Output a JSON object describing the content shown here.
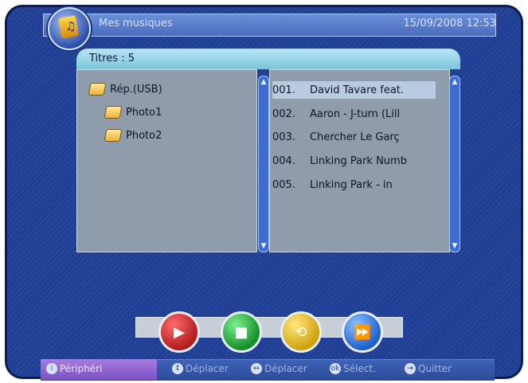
{
  "header": {
    "title": "Mes musiques",
    "datetime": "15/09/2008  12:53",
    "logo_icon": "music-folder-icon"
  },
  "panel": {
    "count_label": "Titres :   5"
  },
  "folders": [
    {
      "label": "Rép.(USB)",
      "icon": "folder-open-icon"
    },
    {
      "label": "Photo1",
      "icon": "folder-icon"
    },
    {
      "label": "Photo2",
      "icon": "folder-icon"
    }
  ],
  "tracks": [
    {
      "num": "001.",
      "title": "David Tavare feat."
    },
    {
      "num": "002.",
      "title": "Aaron - J-turn (Lill"
    },
    {
      "num": "003.",
      "title": "Chercher Le Garç"
    },
    {
      "num": "004.",
      "title": "Linking Park Numb"
    },
    {
      "num": "005.",
      "title": "Linking Park - in"
    }
  ],
  "controls": {
    "play_icon": "play-icon",
    "stop_icon": "stop-icon",
    "repeat_icon": "repeat-icon",
    "fast_forward_icon": "fast-forward-icon"
  },
  "footer": {
    "peripheral": "Périphéri",
    "move_vertical": "Déplacer",
    "move_horizontal": "Déplacer",
    "select": "Sélect.",
    "quit": "Quitter"
  },
  "colors": {
    "background": "#1f3f94",
    "header_bar": "#5f83cf",
    "pane": "#8e9cab",
    "panel_header": "#9ad4e6"
  }
}
